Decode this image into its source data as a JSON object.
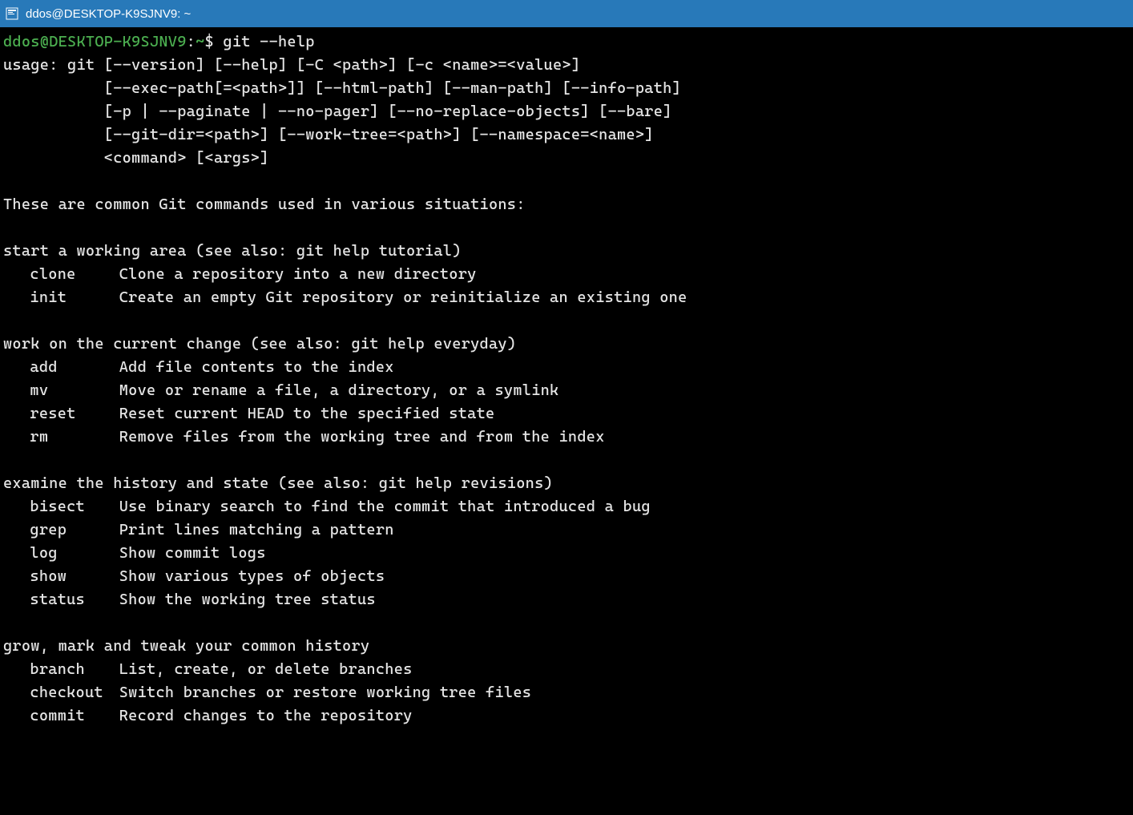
{
  "titlebar": {
    "title": "ddos@DESKTOP-K9SJNV9: ~"
  },
  "prompt": {
    "user_host": "ddos@DESKTOP-K9SJNV9",
    "colon": ":",
    "path": "~",
    "dollar": "$",
    "command": "git --help"
  },
  "usage": {
    "lines": [
      "usage: git [--version] [--help] [-C <path>] [-c <name>=<value>]",
      "           [--exec-path[=<path>]] [--html-path] [--man-path] [--info-path]",
      "           [-p | --paginate | --no-pager] [--no-replace-objects] [--bare]",
      "           [--git-dir=<path>] [--work-tree=<path>] [--namespace=<name>]",
      "           <command> [<args>]"
    ]
  },
  "intro": "These are common Git commands used in various situations:",
  "sections": [
    {
      "heading": "start a working area (see also: git help tutorial)",
      "commands": [
        {
          "name": "clone",
          "desc": "Clone a repository into a new directory"
        },
        {
          "name": "init",
          "desc": "Create an empty Git repository or reinitialize an existing one"
        }
      ]
    },
    {
      "heading": "work on the current change (see also: git help everyday)",
      "commands": [
        {
          "name": "add",
          "desc": "Add file contents to the index"
        },
        {
          "name": "mv",
          "desc": "Move or rename a file, a directory, or a symlink"
        },
        {
          "name": "reset",
          "desc": "Reset current HEAD to the specified state"
        },
        {
          "name": "rm",
          "desc": "Remove files from the working tree and from the index"
        }
      ]
    },
    {
      "heading": "examine the history and state (see also: git help revisions)",
      "commands": [
        {
          "name": "bisect",
          "desc": "Use binary search to find the commit that introduced a bug"
        },
        {
          "name": "grep",
          "desc": "Print lines matching a pattern"
        },
        {
          "name": "log",
          "desc": "Show commit logs"
        },
        {
          "name": "show",
          "desc": "Show various types of objects"
        },
        {
          "name": "status",
          "desc": "Show the working tree status"
        }
      ]
    },
    {
      "heading": "grow, mark and tweak your common history",
      "commands": [
        {
          "name": "branch",
          "desc": "List, create, or delete branches"
        },
        {
          "name": "checkout",
          "desc": "Switch branches or restore working tree files"
        },
        {
          "name": "commit",
          "desc": "Record changes to the repository"
        }
      ]
    }
  ]
}
